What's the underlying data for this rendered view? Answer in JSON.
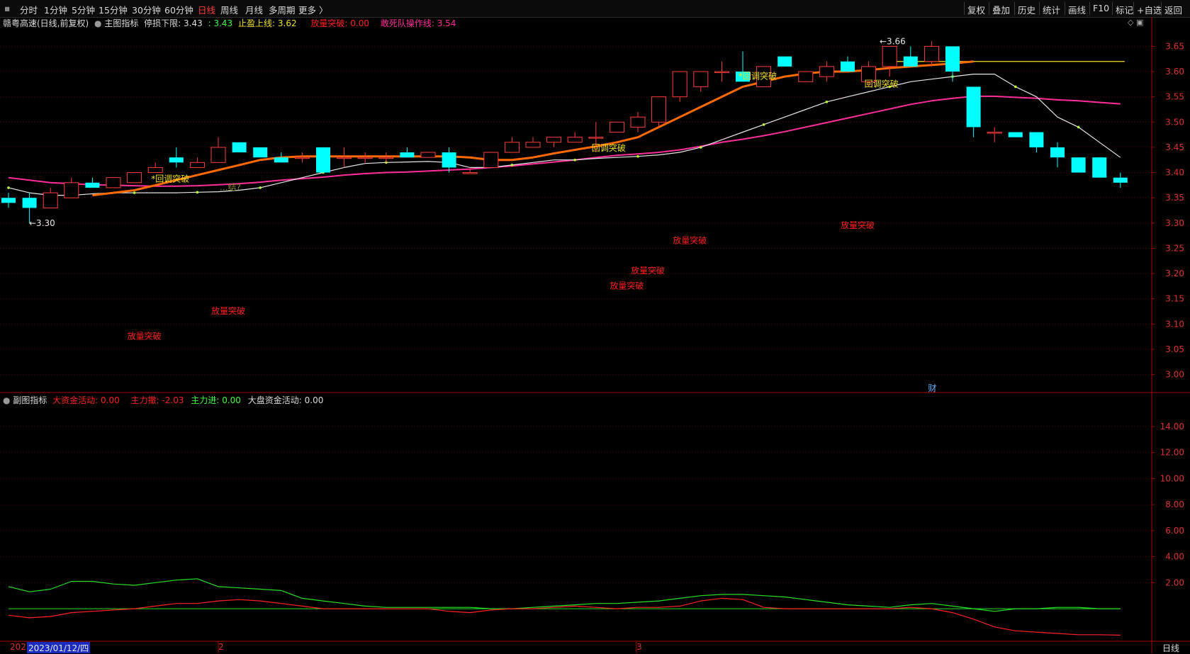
{
  "toolbar": {
    "periods": [
      "分时",
      "1分钟",
      "5分钟",
      "15分钟",
      "30分钟",
      "60分钟",
      "日线",
      "周线",
      "月线",
      "多周期",
      "更多 〉"
    ],
    "active_period": "日线",
    "right_items": [
      "复权",
      "叠加",
      "历史",
      "统计",
      "画线",
      "F10",
      "标记",
      "+自选",
      "返回"
    ]
  },
  "main_legend": {
    "stock_title": "赣粤高速(日线,前复权)",
    "indicator_label": "主图指标",
    "stop_loss_label": "停损下限:",
    "stop_loss_value": "3.43",
    "mid_value": ": 3.43",
    "take_profit_label": "止盈上线:",
    "take_profit_value": "3.62",
    "volume_break_label": "放量突破:",
    "volume_break_value": "0.00",
    "dare_die_label": "敢死队操作线:",
    "dare_die_value": "3.54",
    "window_icons": "◇ ▣"
  },
  "sub_legend": {
    "indicator_label": "副图指标",
    "big_fund_label": "大资金活动:",
    "big_fund_value": "0.00",
    "main_out_label": "主力撤:",
    "main_out_value": "-2.03",
    "main_in_label": "主力进:",
    "main_in_value": "0.00",
    "market_fund_label": "大盘资金活动:",
    "market_fund_value": "0.00"
  },
  "price_axis": [
    "3.65",
    "3.60",
    "3.55",
    "3.50",
    "3.45",
    "3.40",
    "3.35",
    "3.30",
    "3.25",
    "3.20",
    "3.15",
    "3.10",
    "3.05",
    "3.00"
  ],
  "sub_axis": [
    "14.00",
    "12.00",
    "10.00",
    "8.00",
    "6.00",
    "4.00",
    "2.00"
  ],
  "date_bar": {
    "left_partial": "202",
    "selected_date": "2023/01/12/四",
    "month_2": "2",
    "month_3": "3",
    "period_label": "日线"
  },
  "annotations": {
    "low_price": "←3.30",
    "high_price": "←3.66",
    "pullback_label": "回调突破",
    "pullback_star": "*回调突破",
    "volume_break_label": "放量突破",
    "finance_badge": "财",
    "faint_label": "...结?"
  },
  "chart_data": {
    "type": "candlestick",
    "price_ylim": [
      2.97,
      3.68
    ],
    "sub_ylim": [
      -2.5,
      16.5
    ],
    "candles": [
      {
        "o": 3.35,
        "h": 3.36,
        "l": 3.33,
        "c": 3.34
      },
      {
        "o": 3.35,
        "h": 3.36,
        "l": 3.3,
        "c": 3.33
      },
      {
        "o": 3.33,
        "h": 3.37,
        "l": 3.33,
        "c": 3.36
      },
      {
        "o": 3.35,
        "h": 3.39,
        "l": 3.35,
        "c": 3.38
      },
      {
        "o": 3.38,
        "h": 3.39,
        "l": 3.37,
        "c": 3.37
      },
      {
        "o": 3.37,
        "h": 3.39,
        "l": 3.37,
        "c": 3.39
      },
      {
        "o": 3.38,
        "h": 3.4,
        "l": 3.38,
        "c": 3.4
      },
      {
        "o": 3.4,
        "h": 3.42,
        "l": 3.4,
        "c": 3.41
      },
      {
        "o": 3.43,
        "h": 3.45,
        "l": 3.41,
        "c": 3.42
      },
      {
        "o": 3.41,
        "h": 3.43,
        "l": 3.41,
        "c": 3.42
      },
      {
        "o": 3.42,
        "h": 3.47,
        "l": 3.42,
        "c": 3.45
      },
      {
        "o": 3.46,
        "h": 3.46,
        "l": 3.44,
        "c": 3.44
      },
      {
        "o": 3.45,
        "h": 3.45,
        "l": 3.43,
        "c": 3.43
      },
      {
        "o": 3.43,
        "h": 3.44,
        "l": 3.42,
        "c": 3.42
      },
      {
        "o": 3.43,
        "h": 3.44,
        "l": 3.42,
        "c": 3.43
      },
      {
        "o": 3.45,
        "h": 3.45,
        "l": 3.4,
        "c": 3.4
      },
      {
        "o": 3.43,
        "h": 3.45,
        "l": 3.41,
        "c": 3.43
      },
      {
        "o": 3.43,
        "h": 3.44,
        "l": 3.42,
        "c": 3.43
      },
      {
        "o": 3.43,
        "h": 3.44,
        "l": 3.42,
        "c": 3.43
      },
      {
        "o": 3.44,
        "h": 3.45,
        "l": 3.43,
        "c": 3.43
      },
      {
        "o": 3.43,
        "h": 3.44,
        "l": 3.43,
        "c": 3.44
      },
      {
        "o": 3.44,
        "h": 3.45,
        "l": 3.4,
        "c": 3.41
      },
      {
        "o": 3.4,
        "h": 3.41,
        "l": 3.4,
        "c": 3.4
      },
      {
        "o": 3.41,
        "h": 3.44,
        "l": 3.41,
        "c": 3.44
      },
      {
        "o": 3.44,
        "h": 3.47,
        "l": 3.44,
        "c": 3.46
      },
      {
        "o": 3.45,
        "h": 3.47,
        "l": 3.45,
        "c": 3.46
      },
      {
        "o": 3.46,
        "h": 3.47,
        "l": 3.45,
        "c": 3.47
      },
      {
        "o": 3.46,
        "h": 3.48,
        "l": 3.46,
        "c": 3.47
      },
      {
        "o": 3.47,
        "h": 3.5,
        "l": 3.44,
        "c": 3.47
      },
      {
        "o": 3.48,
        "h": 3.5,
        "l": 3.48,
        "c": 3.5
      },
      {
        "o": 3.49,
        "h": 3.52,
        "l": 3.48,
        "c": 3.51
      },
      {
        "o": 3.5,
        "h": 3.55,
        "l": 3.49,
        "c": 3.55
      },
      {
        "o": 3.55,
        "h": 3.6,
        "l": 3.54,
        "c": 3.6
      },
      {
        "o": 3.57,
        "h": 3.6,
        "l": 3.56,
        "c": 3.6
      },
      {
        "o": 3.6,
        "h": 3.62,
        "l": 3.58,
        "c": 3.6
      },
      {
        "o": 3.6,
        "h": 3.64,
        "l": 3.58,
        "c": 3.58
      },
      {
        "o": 3.57,
        "h": 3.61,
        "l": 3.57,
        "c": 3.61
      },
      {
        "o": 3.63,
        "h": 3.63,
        "l": 3.61,
        "c": 3.61
      },
      {
        "o": 3.58,
        "h": 3.6,
        "l": 3.58,
        "c": 3.6
      },
      {
        "o": 3.59,
        "h": 3.62,
        "l": 3.58,
        "c": 3.61
      },
      {
        "o": 3.62,
        "h": 3.63,
        "l": 3.6,
        "c": 3.6
      },
      {
        "o": 3.58,
        "h": 3.62,
        "l": 3.57,
        "c": 3.61
      },
      {
        "o": 3.61,
        "h": 3.65,
        "l": 3.59,
        "c": 3.65
      },
      {
        "o": 3.63,
        "h": 3.65,
        "l": 3.62,
        "c": 3.61
      },
      {
        "o": 3.62,
        "h": 3.66,
        "l": 3.61,
        "c": 3.65
      },
      {
        "o": 3.65,
        "h": 3.65,
        "l": 3.58,
        "c": 3.6
      },
      {
        "o": 3.57,
        "h": 3.57,
        "l": 3.47,
        "c": 3.49
      },
      {
        "o": 3.48,
        "h": 3.49,
        "l": 3.46,
        "c": 3.48
      },
      {
        "o": 3.48,
        "h": 3.48,
        "l": 3.47,
        "c": 3.47
      },
      {
        "o": 3.48,
        "h": 3.48,
        "l": 3.44,
        "c": 3.45
      },
      {
        "o": 3.45,
        "h": 3.46,
        "l": 3.41,
        "c": 3.43
      },
      {
        "o": 3.43,
        "h": 3.43,
        "l": 3.4,
        "c": 3.4
      },
      {
        "o": 3.43,
        "h": 3.43,
        "l": 3.39,
        "c": 3.39
      },
      {
        "o": 3.39,
        "h": 3.4,
        "l": 3.37,
        "c": 3.38
      }
    ],
    "series": [
      {
        "key": "magenta",
        "values": [
          3.39,
          3.385,
          3.38,
          3.378,
          3.376,
          3.375,
          3.374,
          3.373,
          3.373,
          3.374,
          3.376,
          3.378,
          3.381,
          3.385,
          3.388,
          3.391,
          3.395,
          3.398,
          3.4,
          3.401,
          3.403,
          3.405,
          3.407,
          3.41,
          3.413,
          3.417,
          3.421,
          3.425,
          3.43,
          3.434,
          3.437,
          3.44,
          3.445,
          3.452,
          3.46,
          3.466,
          3.473,
          3.481,
          3.49,
          3.499,
          3.508,
          3.517,
          3.526,
          3.535,
          3.542,
          3.547,
          3.551,
          3.551,
          3.549,
          3.547,
          3.544,
          3.542,
          3.539,
          3.536
        ]
      },
      {
        "key": "white",
        "values": [
          3.37,
          3.36,
          3.355,
          3.355,
          3.358,
          3.36,
          3.36,
          3.36,
          3.36,
          3.361,
          3.362,
          3.365,
          3.37,
          3.38,
          3.39,
          3.4,
          3.41,
          3.418,
          3.42,
          3.421,
          3.422,
          3.42,
          3.41,
          3.41,
          3.415,
          3.42,
          3.425,
          3.425,
          3.428,
          3.43,
          3.432,
          3.435,
          3.44,
          3.45,
          3.465,
          3.48,
          3.495,
          3.51,
          3.525,
          3.54,
          3.55,
          3.56,
          3.57,
          3.58,
          3.585,
          3.59,
          3.595,
          3.595,
          3.57,
          3.55,
          3.51,
          3.49,
          3.46,
          3.43
        ]
      },
      {
        "key": "orange",
        "start": 4,
        "values": [
          3.355,
          3.36,
          3.365,
          3.375,
          3.385,
          3.395,
          3.405,
          3.415,
          3.425,
          3.43,
          3.432,
          3.432,
          3.432,
          3.432,
          3.432,
          3.432,
          3.432,
          3.432,
          3.43,
          3.425,
          3.425,
          3.43,
          3.438,
          3.445,
          3.452,
          3.46,
          3.47,
          3.49,
          3.51,
          3.53,
          3.55,
          3.57,
          3.58,
          3.59,
          3.596,
          3.6,
          3.6,
          3.603,
          3.607,
          3.61,
          3.613,
          3.616,
          3.62
        ]
      }
    ],
    "yellow_line_value": 3.62,
    "sub_series": [
      {
        "key": "green",
        "values": [
          1.7,
          1.3,
          1.5,
          2.1,
          2.1,
          1.9,
          1.8,
          2.0,
          2.2,
          2.3,
          1.7,
          1.6,
          1.5,
          1.4,
          0.8,
          0.6,
          0.4,
          0.2,
          0.1,
          0.1,
          0.1,
          0.1,
          0.1,
          0.0,
          0.0,
          0.1,
          0.2,
          0.3,
          0.4,
          0.4,
          0.5,
          0.6,
          0.8,
          1.0,
          1.1,
          1.1,
          1.0,
          0.9,
          0.7,
          0.5,
          0.3,
          0.2,
          0.1,
          0.3,
          0.4,
          0.2,
          0.0,
          -0.2,
          0.0,
          0.0,
          0.1,
          0.1,
          0.0,
          0.0
        ]
      },
      {
        "key": "red",
        "values": [
          -0.5,
          -0.7,
          -0.6,
          -0.3,
          -0.2,
          -0.1,
          0.0,
          0.2,
          0.4,
          0.4,
          0.6,
          0.7,
          0.6,
          0.4,
          0.2,
          0.0,
          0.0,
          0.0,
          0.0,
          0.0,
          0.0,
          -0.2,
          -0.3,
          -0.1,
          0.0,
          0.0,
          0.1,
          0.2,
          0.1,
          0.0,
          0.1,
          0.1,
          0.2,
          0.6,
          0.8,
          0.7,
          0.1,
          0.0,
          0.0,
          0.0,
          0.0,
          0.0,
          0.0,
          0.1,
          0.0,
          -0.3,
          -0.8,
          -1.4,
          -1.7,
          -1.8,
          -1.9,
          -2.0,
          -2.0,
          -2.03
        ]
      }
    ],
    "pullback_marks": [
      {
        "i": 7,
        "p": 3.382,
        "star": true
      },
      {
        "i": 28,
        "p": 3.443,
        "star": false
      },
      {
        "i": 35,
        "p": 3.585,
        "star": true
      },
      {
        "i": 41,
        "p": 3.57,
        "star": false
      }
    ],
    "volume_marks": [
      {
        "i": 6,
        "p": 3.07
      },
      {
        "i": 10,
        "p": 3.12
      },
      {
        "i": 29,
        "p": 3.17
      },
      {
        "i": 30,
        "p": 3.2
      },
      {
        "i": 32,
        "p": 3.26
      },
      {
        "i": 40,
        "p": 3.29
      }
    ],
    "colors": {
      "up": "#ff3c3c",
      "down": "#00ffff",
      "magenta": "#ff2d9a",
      "white": "#e6e6e6",
      "orange": "#ff6a00",
      "yellow": "#f0e020",
      "green": "#26e026",
      "red": "#ff2020",
      "axis": "#b00000",
      "grid": "#5a0000",
      "marker": "#b8ff30"
    }
  }
}
